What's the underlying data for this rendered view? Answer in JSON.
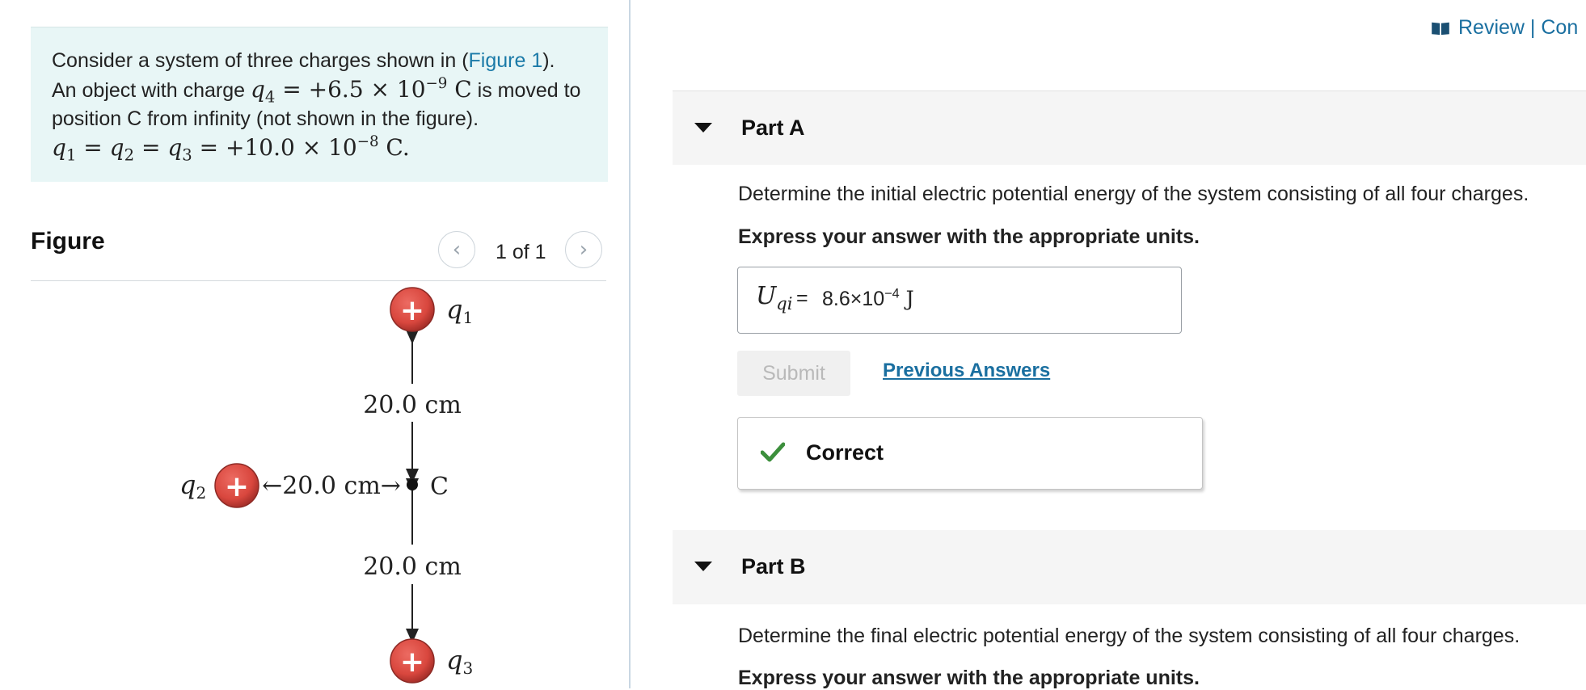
{
  "problem": {
    "line1_text": "Consider a system of three charges shown in (",
    "figure_link": "Figure 1",
    "line1_end": ").",
    "line2_pre": "An object with charge ",
    "q4_var": "q",
    "q4_sub": "4",
    "q4_value": " = +6.5 × 10",
    "q4_exp": "−9",
    "q4_unit": " C",
    "line2_post": " is moved to",
    "line3": "position C from infinity (not shown in the figure).",
    "q_equal": "q",
    "q1_sub": "1",
    "eq1": " = ",
    "q2_sub": "2",
    "eq2": " = ",
    "q3_sub": "3",
    "q_value": " = +10.0 × 10",
    "q_exp": "−8",
    "q_unit": " C."
  },
  "figure": {
    "heading": "Figure",
    "counter": "1 of 1",
    "prev_icon": "chevron-left-icon",
    "next_icon": "chevron-right-icon",
    "prev_glyph": "‹",
    "next_glyph": "›",
    "q1_label": "q",
    "q1_sub": "1",
    "q2_label": "q",
    "q2_sub": "2",
    "q3_label": "q",
    "q3_sub": "3",
    "distance_top": "20.0 cm",
    "distance_left": "←20.0 cm→",
    "distance_bottom": "20.0 cm",
    "point_label": "C",
    "charge_sign": "+",
    "charge_color": "#d9473e"
  },
  "header": {
    "review_link": "Review | Con",
    "review_icon": "book-icon"
  },
  "partA": {
    "title": "Part A",
    "question": "Determine the initial electric potential energy of the system consisting of all four charges.",
    "instruction": "Express your answer with the appropriate units.",
    "answer_var": "U",
    "answer_sub": "qi",
    "answer_eq": "=",
    "answer_mantissa": "8.6×10",
    "answer_exp": "−4",
    "answer_unit": " J",
    "submit_label": "Submit",
    "previous_answers": "Previous Answers",
    "feedback": "Correct",
    "feedback_color": "#3c8f3c"
  },
  "partB": {
    "title": "Part B",
    "question": "Determine the final electric potential energy of the system consisting of all four charges.",
    "instruction": "Express your answer with the appropriate units."
  },
  "colors": {
    "link": "#1a6fa0",
    "problem_bg": "#e8f6f6",
    "part_header_bg": "#f5f5f5"
  }
}
